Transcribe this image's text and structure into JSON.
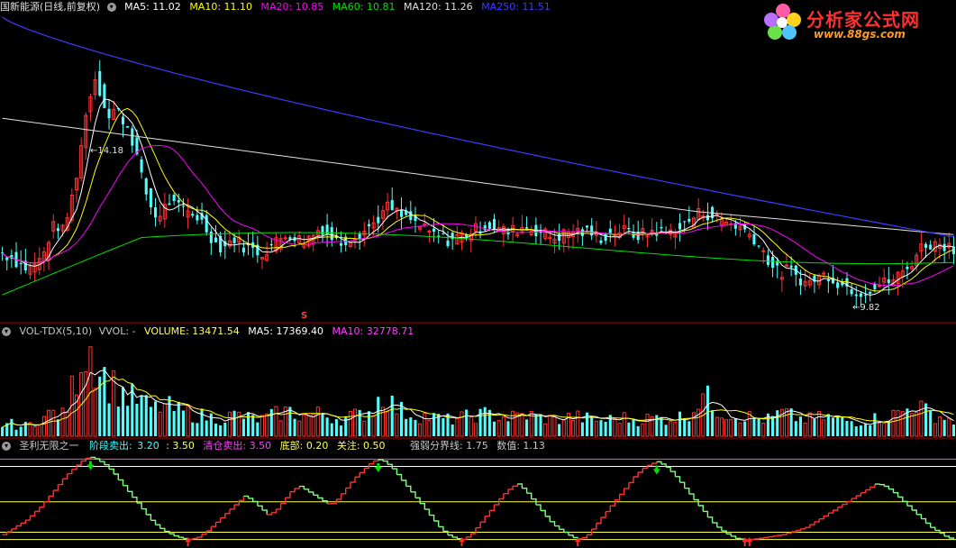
{
  "price_header": {
    "title": "国新能源(日线,前复权)",
    "ma5": "MA5: 11.02",
    "ma10": "MA10: 11.10",
    "ma20": "MA20: 10.85",
    "ma60": "MA60: 10.81",
    "ma120": "MA120: 11.26",
    "ma250": "MA250: 11.51"
  },
  "price_annotations": {
    "high": "14.18",
    "low": "9.82",
    "marker": "S"
  },
  "volume_header": {
    "title": "VOL-TDX(5,10)",
    "vvol": "VVOL: -",
    "volume": "VOLUME: 13471.54",
    "ma5": "MA5: 17369.40",
    "ma10": "MA10: 32778.71"
  },
  "indicator_header": {
    "title": "圣利无限之一",
    "stage_sell_label": "阶段卖出:",
    "stage_sell_value": "3.20",
    "stage_sell_value2": ": 3.50",
    "clear_sell": "清仓卖出: 3.50",
    "bottom": "底部: 0.20",
    "watch": "关注: 0.50",
    "strength": "强弱分界线: 1.75",
    "value": "数值: 1.13"
  },
  "logo": {
    "text": "分析家公式网",
    "url": "www.88gs.com"
  },
  "colors": {
    "up": "#ff3232",
    "down": "#54fcfc",
    "ma5": "#ffffff",
    "ma10": "#ffff00",
    "ma20": "#ff00ff",
    "ma60": "#00e000",
    "ma120": "#e0e0e0",
    "ma250": "#3c3cff",
    "green_line": "#00ff00",
    "indicator_red": "#ff3232",
    "indicator_green": "#80ff80",
    "separator": "#b00000"
  },
  "chart_data": {
    "type": "candlestick",
    "price_ylim": [
      9.3,
      15.2
    ],
    "volume_ylim": [
      0,
      100
    ],
    "indicator_ylim": [
      0,
      3.7
    ],
    "indicator_levels": {
      "stage_sell": 3.2,
      "clear_sell": 3.5,
      "bottom": 0.2,
      "watch": 0.5,
      "strength": 1.75
    },
    "high": 14.18,
    "low": 9.82,
    "close_path": [
      10.6,
      10.55,
      10.45,
      10.35,
      10.3,
      10.4,
      10.5,
      10.9,
      11.2,
      11.0,
      11.4,
      12.0,
      12.8,
      13.6,
      14.0,
      13.6,
      13.2,
      13.4,
      13.2,
      13.0,
      12.6,
      12.0,
      11.6,
      11.3,
      11.4,
      11.6,
      11.5,
      11.45,
      11.4,
      11.35,
      11.2,
      11.0,
      10.8,
      10.7,
      10.8,
      10.9,
      10.75,
      10.7,
      10.65,
      10.6,
      10.7,
      10.8,
      10.9,
      11.0,
      10.9,
      10.85,
      10.9,
      11.0,
      11.1,
      10.95,
      10.85,
      10.8,
      10.9,
      10.95,
      11.0,
      11.1,
      11.2,
      11.35,
      11.5,
      11.4,
      11.3,
      11.25,
      11.2,
      11.1,
      11.0,
      10.95,
      10.9,
      10.85,
      10.9,
      10.95,
      11.0,
      11.05,
      11.1,
      11.15,
      11.1,
      11.05,
      11.0,
      11.05,
      11.1,
      11.1,
      11.05,
      11.0,
      10.95,
      10.9,
      10.95,
      11.0,
      11.05,
      11.0,
      11.0,
      10.95,
      10.9,
      10.95,
      11.0,
      11.05,
      11.0,
      10.95,
      10.95,
      11.0,
      11.05,
      11.0,
      11.0,
      11.05,
      11.1,
      11.2,
      11.3,
      11.4,
      11.35,
      11.3,
      11.25,
      11.2,
      11.15,
      11.1,
      11.0,
      10.9,
      10.7,
      10.5,
      10.3,
      10.2,
      10.3,
      10.2,
      10.1,
      10.0,
      10.1,
      10.15,
      10.2,
      10.1,
      10.0,
      9.95,
      9.9,
      9.85,
      9.9,
      9.95,
      10.0,
      10.05,
      10.1,
      10.2,
      10.3,
      10.5,
      10.7,
      10.8,
      10.75,
      10.8,
      10.75,
      10.7
    ],
    "volume_path": [
      12,
      14,
      11,
      10,
      12,
      15,
      18,
      22,
      25,
      20,
      35,
      60,
      88,
      95,
      80,
      65,
      55,
      50,
      45,
      40,
      38,
      35,
      30,
      28,
      32,
      30,
      27,
      25,
      24,
      22,
      21,
      20,
      19,
      18,
      20,
      22,
      21,
      19,
      18,
      17,
      20,
      22,
      24,
      26,
      23,
      21,
      20,
      22,
      24,
      21,
      19,
      18,
      20,
      21,
      22,
      26,
      30,
      45,
      38,
      30,
      26,
      24,
      22,
      21,
      20,
      19,
      18,
      17,
      18,
      19,
      20,
      21,
      22,
      23,
      21,
      20,
      19,
      20,
      21,
      22,
      20,
      19,
      18,
      17,
      18,
      19,
      20,
      19,
      18,
      17,
      16,
      17,
      18,
      19,
      18,
      17,
      17,
      18,
      19,
      18,
      18,
      19,
      20,
      24,
      28,
      45,
      38,
      30,
      26,
      24,
      22,
      21,
      20,
      19,
      18,
      17,
      20,
      24,
      22,
      20,
      18,
      17,
      18,
      19,
      20,
      18,
      17,
      16,
      15,
      16,
      17,
      18,
      19,
      20,
      22,
      24,
      28,
      35,
      30,
      24,
      22,
      20,
      18,
      16
    ],
    "indicator_path": [
      0.4,
      0.6,
      0.8,
      1.0,
      1.3,
      1.6,
      2.0,
      2.4,
      2.8,
      3.1,
      3.4,
      3.6,
      3.5,
      3.3,
      3.0,
      2.6,
      2.2,
      1.8,
      1.4,
      1.0,
      0.7,
      0.5,
      0.35,
      0.25,
      0.2,
      0.3,
      0.5,
      0.8,
      1.1,
      1.4,
      1.7,
      2.0,
      1.8,
      1.5,
      1.2,
      1.4,
      1.8,
      2.2,
      2.4,
      2.2,
      2.0,
      1.8,
      1.6,
      1.9,
      2.3,
      2.7,
      3.0,
      3.3,
      3.5,
      3.4,
      3.1,
      2.7,
      2.3,
      1.9,
      1.5,
      1.1,
      0.7,
      0.4,
      0.25,
      0.2,
      0.4,
      0.8,
      1.2,
      1.6,
      2.0,
      2.3,
      2.5,
      2.2,
      1.8,
      1.4,
      1.0,
      0.7,
      0.5,
      0.3,
      0.2,
      0.4,
      0.8,
      1.2,
      1.6,
      2.0,
      2.4,
      2.8,
      3.1,
      3.3,
      3.4,
      3.2,
      2.9,
      2.5,
      2.1,
      1.7,
      1.3,
      0.9,
      0.6,
      0.4,
      0.25,
      0.2,
      0.2,
      0.25,
      0.3,
      0.35,
      0.4,
      0.5,
      0.6,
      0.7,
      0.9,
      1.1,
      1.3,
      1.5,
      1.7,
      1.9,
      2.1,
      2.3,
      2.5,
      2.4,
      2.2,
      1.9,
      1.6,
      1.3,
      1.0,
      0.7,
      0.5,
      0.3,
      0.2
    ]
  }
}
